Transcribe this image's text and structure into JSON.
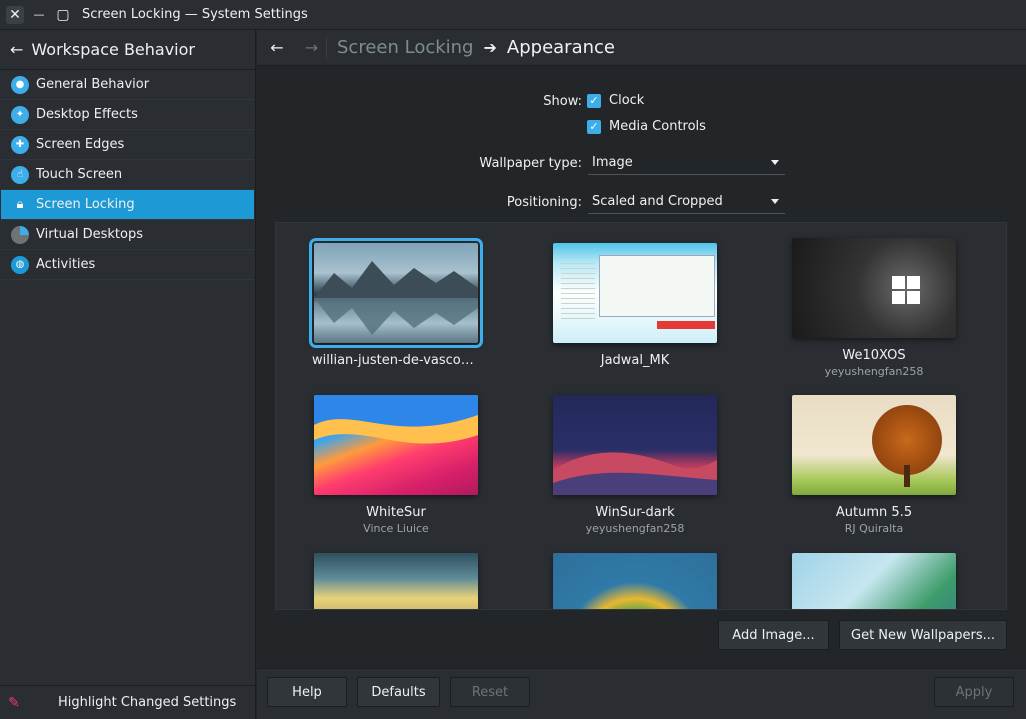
{
  "window": {
    "title": "Screen Locking — System Settings",
    "close_glyph": "✕",
    "minimize_glyph": "—",
    "maximize_glyph": "▢"
  },
  "sidebar": {
    "header": "Workspace Behavior",
    "back_glyph": "←",
    "items": [
      {
        "label": "General Behavior",
        "icon": "general-behavior-icon",
        "color": "#3daee9"
      },
      {
        "label": "Desktop Effects",
        "icon": "desktop-effects-icon",
        "color": "#3daee9"
      },
      {
        "label": "Screen Edges",
        "icon": "screen-edges-icon",
        "color": "#3daee9"
      },
      {
        "label": "Touch Screen",
        "icon": "touch-screen-icon",
        "color": "#3daee9"
      },
      {
        "label": "Screen Locking",
        "icon": "lock-icon",
        "color": "#1d99d6",
        "active": true
      },
      {
        "label": "Virtual Desktops",
        "icon": "virtual-desktops-icon",
        "color": "#6e7377"
      },
      {
        "label": "Activities",
        "icon": "activities-icon",
        "color": "#1d99d6"
      }
    ],
    "footer_label": "Highlight Changed Settings"
  },
  "breadcrumb": {
    "back_glyph": "←",
    "forward_glyph": "→",
    "parent": "Screen Locking",
    "separator": "➔",
    "current": "Appearance"
  },
  "form": {
    "show_label": "Show:",
    "clock_label": "Clock",
    "clock_checked": true,
    "media_label": "Media Controls",
    "media_checked": true,
    "wallpaper_type_label": "Wallpaper type:",
    "wallpaper_type_value": "Image",
    "positioning_label": "Positioning:",
    "positioning_value": "Scaled and Cropped"
  },
  "wallpapers": [
    {
      "name": "willian-justen-de-vasconcell…",
      "author": "",
      "selected": true
    },
    {
      "name": "Jadwal_MK",
      "author": ""
    },
    {
      "name": "We10XOS",
      "author": "yeyushengfan258"
    },
    {
      "name": "WhiteSur",
      "author": "Vince Liuice"
    },
    {
      "name": "WinSur-dark",
      "author": "yeyushengfan258"
    },
    {
      "name": "Autumn 5.5",
      "author": "RJ Quiralta"
    }
  ],
  "buttons": {
    "add_image": "Add Image...",
    "get_new": "Get New Wallpapers...",
    "help": "Help",
    "defaults": "Defaults",
    "reset": "Reset",
    "apply": "Apply"
  },
  "colors": {
    "accent": "#3daee9",
    "highlight_pen": "#e93a73"
  }
}
